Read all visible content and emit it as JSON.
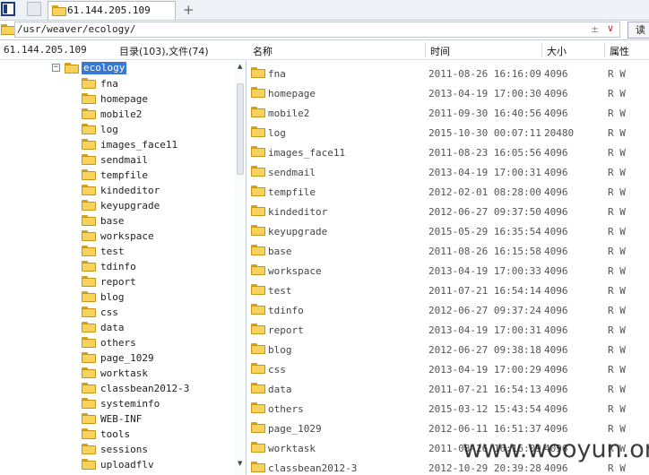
{
  "tab": {
    "label": "61.144.205.109",
    "new_tab_symbol": "+"
  },
  "address": {
    "path": "/usr/weaver/ecology/",
    "plusminus": "±",
    "chevron": "∨",
    "read_button": "读"
  },
  "info": {
    "host": "61.144.205.109",
    "counts": "目录(103),文件(74)"
  },
  "columns": {
    "name": "名称",
    "time": "时间",
    "size": "大小",
    "attr": "属性"
  },
  "tree": {
    "root": "ecology",
    "collapse_symbol": "−",
    "children": [
      "fna",
      "homepage",
      "mobile2",
      "log",
      "images_face11",
      "sendmail",
      "tempfile",
      "kindeditor",
      "keyupgrade",
      "base",
      "workspace",
      "test",
      "tdinfo",
      "report",
      "blog",
      "css",
      "data",
      "others",
      "page_1029",
      "worktask",
      "classbean2012-3",
      "systeminfo",
      "WEB-INF",
      "tools",
      "sessions",
      "uploadflv"
    ]
  },
  "files": [
    {
      "name": "fna",
      "time": "2011-08-26 16:16:09",
      "size": "4096",
      "attr": "R W"
    },
    {
      "name": "homepage",
      "time": "2013-04-19 17:00:30",
      "size": "4096",
      "attr": "R W"
    },
    {
      "name": "mobile2",
      "time": "2011-09-30 16:40:56",
      "size": "4096",
      "attr": "R W"
    },
    {
      "name": "log",
      "time": "2015-10-30 00:07:11",
      "size": "20480",
      "attr": "R W"
    },
    {
      "name": "images_face11",
      "time": "2011-08-23 16:05:56",
      "size": "4096",
      "attr": "R W"
    },
    {
      "name": "sendmail",
      "time": "2013-04-19 17:00:31",
      "size": "4096",
      "attr": "R W"
    },
    {
      "name": "tempfile",
      "time": "2012-02-01 08:28:00",
      "size": "4096",
      "attr": "R W"
    },
    {
      "name": "kindeditor",
      "time": "2012-06-27 09:37:50",
      "size": "4096",
      "attr": "R W"
    },
    {
      "name": "keyupgrade",
      "time": "2015-05-29 16:35:54",
      "size": "4096",
      "attr": "R W"
    },
    {
      "name": "base",
      "time": "2011-08-26 16:15:58",
      "size": "4096",
      "attr": "R W"
    },
    {
      "name": "workspace",
      "time": "2013-04-19 17:00:33",
      "size": "4096",
      "attr": "R W"
    },
    {
      "name": "test",
      "time": "2011-07-21 16:54:14",
      "size": "4096",
      "attr": "R W"
    },
    {
      "name": "tdinfo",
      "time": "2012-06-27 09:37:24",
      "size": "4096",
      "attr": "R W"
    },
    {
      "name": "report",
      "time": "2013-04-19 17:00:31",
      "size": "4096",
      "attr": "R W"
    },
    {
      "name": "blog",
      "time": "2012-06-27 09:38:18",
      "size": "4096",
      "attr": "R W"
    },
    {
      "name": "css",
      "time": "2013-04-19 17:00:29",
      "size": "4096",
      "attr": "R W"
    },
    {
      "name": "data",
      "time": "2011-07-21 16:54:13",
      "size": "4096",
      "attr": "R W"
    },
    {
      "name": "others",
      "time": "2015-03-12 15:43:54",
      "size": "4096",
      "attr": "R W"
    },
    {
      "name": "page_1029",
      "time": "2012-06-11 16:51:37",
      "size": "4096",
      "attr": "R W"
    },
    {
      "name": "worktask",
      "time": "2011-08-26 16:16:09",
      "size": "4096",
      "attr": "R W"
    },
    {
      "name": "classbean2012-3",
      "time": "2012-10-29 20:39:28",
      "size": "4096",
      "attr": "R W"
    }
  ],
  "watermark": "www.wooyun.org"
}
